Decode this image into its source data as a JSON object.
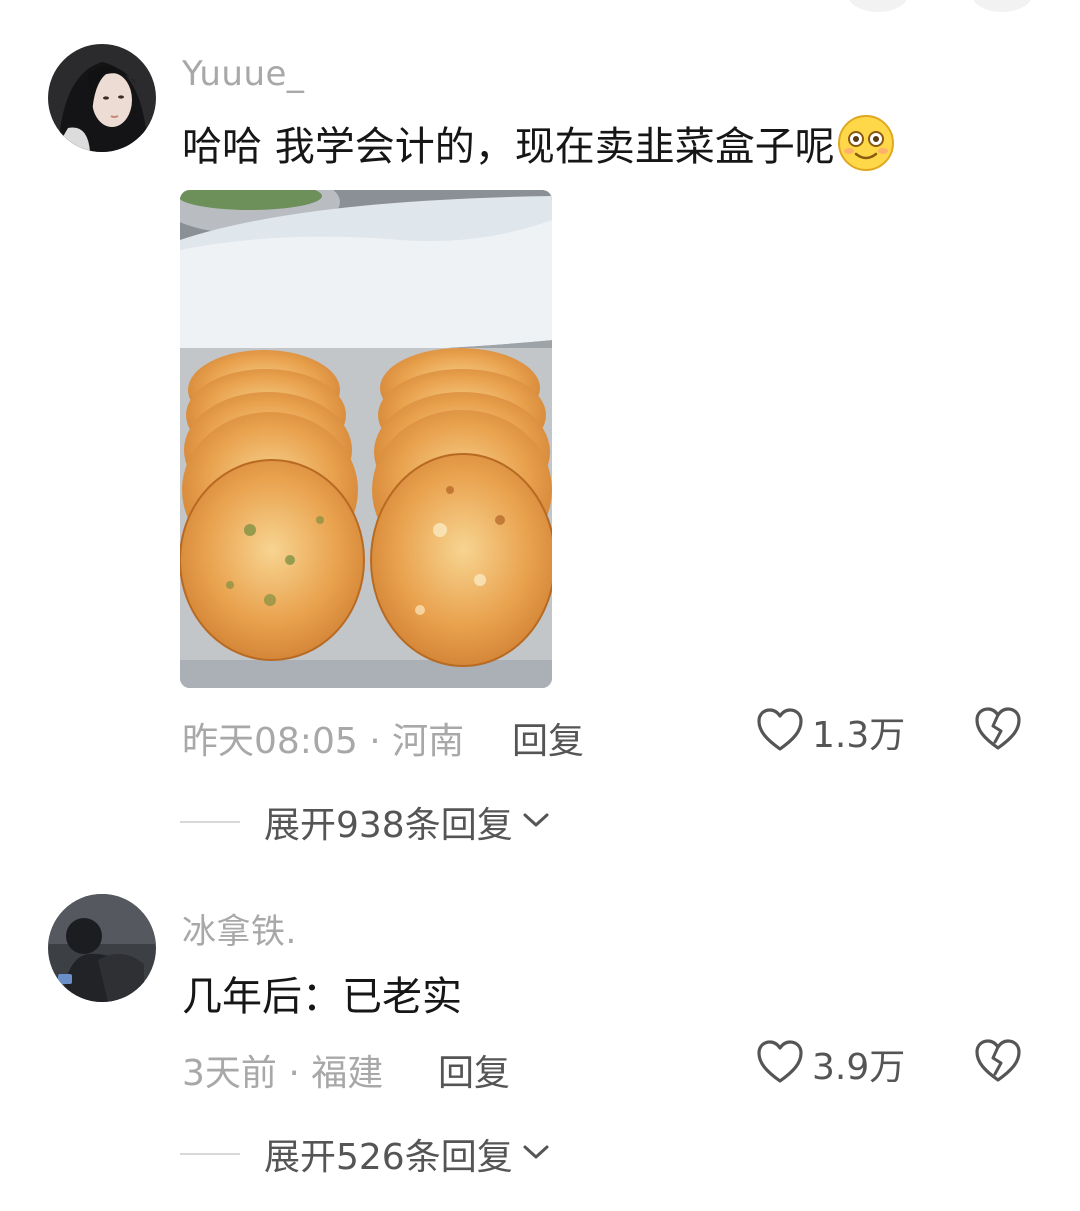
{
  "comments": [
    {
      "username": "Yuuue_",
      "text": "哈哈 我学会计的，现在卖韭菜盒子呢",
      "emoji_icon": "smiling-face-emoji",
      "has_image": true,
      "meta": "昨天08:05 · 河南",
      "reply_label": "回复",
      "like_count": "1.3万",
      "expand_label": "展开938条回复"
    },
    {
      "username": "冰拿铁.",
      "text": "几年后：已老实",
      "meta": "3天前 · 福建",
      "reply_label": "回复",
      "like_count": "3.9万",
      "expand_label": "展开526条回复"
    }
  ],
  "icons": {
    "like": "heart-outline-icon",
    "dislike": "broken-heart-icon",
    "expand": "chevron-down-icon"
  },
  "colors": {
    "username": "#a8a8a8",
    "text": "#161616",
    "action": "#555555"
  }
}
